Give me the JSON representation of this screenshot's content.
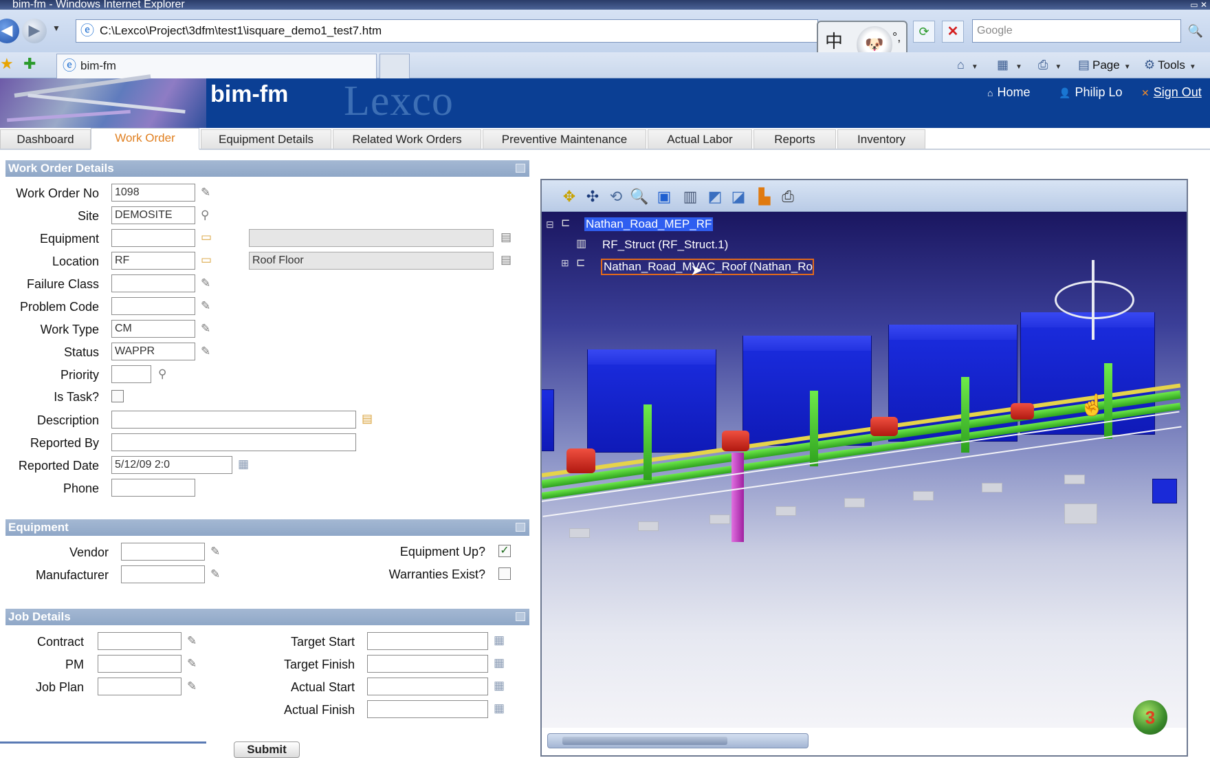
{
  "window": {
    "title": "bim-fm - Windows Internet Explorer"
  },
  "browser": {
    "address": "C:\\Lexco\\Project\\3dfm\\test1\\isquare_demo1_test7.htm",
    "search_placeholder": "Google",
    "tab_title": "bim-fm",
    "ime": {
      "lang": "中",
      "punct": "°,"
    },
    "commands": {
      "page": "Page",
      "tools": "Tools"
    }
  },
  "app": {
    "logo": "bim-fm",
    "watermark": "Lexco",
    "header_links": {
      "home": "Home",
      "user": "Philip Lo",
      "signout": "Sign Out"
    },
    "tabs": [
      "Dashboard",
      "Work Order",
      "Equipment Details",
      "Related Work Orders",
      "Preventive Maintenance",
      "Actual Labor",
      "Reports",
      "Inventory"
    ],
    "active_tab": "Work Order"
  },
  "work_order": {
    "heading": "Work Order Details",
    "labels": {
      "work_order_no": "Work Order No",
      "site": "Site",
      "equipment": "Equipment",
      "location": "Location",
      "failure_class": "Failure Class",
      "problem_code": "Problem Code",
      "work_type": "Work Type",
      "status": "Status",
      "priority": "Priority",
      "is_task": "Is Task?",
      "description": "Description",
      "reported_by": "Reported By",
      "reported_date": "Reported Date",
      "phone": "Phone"
    },
    "values": {
      "work_order_no": "1098",
      "site": "DEMOSITE",
      "equipment": "",
      "equipment_desc": "",
      "location": "RF",
      "location_desc": "Roof Floor",
      "failure_class": "",
      "problem_code": "",
      "work_type": "CM",
      "status": "WAPPR",
      "priority": "",
      "is_task": false,
      "description": "",
      "reported_by": "",
      "reported_date": "5/12/09 2:0",
      "phone": ""
    }
  },
  "equipment": {
    "heading": "Equipment",
    "labels": {
      "vendor": "Vendor",
      "manufacturer": "Manufacturer",
      "equipment_up": "Equipment Up?",
      "warranties_exist": "Warranties Exist?"
    },
    "values": {
      "vendor": "",
      "manufacturer": "",
      "equipment_up": true,
      "warranties_exist": false
    }
  },
  "job_details": {
    "heading": "Job Details",
    "labels": {
      "contract": "Contract",
      "pm": "PM",
      "job_plan": "Job Plan",
      "target_start": "Target Start",
      "target_finish": "Target Finish",
      "actual_start": "Actual Start",
      "actual_finish": "Actual Finish"
    },
    "values": {
      "contract": "",
      "pm": "",
      "job_plan": "",
      "target_start": "",
      "target_finish": "",
      "actual_start": "",
      "actual_finish": ""
    }
  },
  "submit_label": "Submit",
  "viewer": {
    "tree": [
      "Nathan_Road_MEP_RF",
      "RF_Struct (RF_Struct.1)",
      "Nathan_Road_MVAC_Roof (Nathan_Roa"
    ],
    "colors": {
      "units": "#1b2de0",
      "pipes": "#3fc028",
      "hot_pipes": "#d8281a",
      "background_top": "#1a1660"
    }
  }
}
